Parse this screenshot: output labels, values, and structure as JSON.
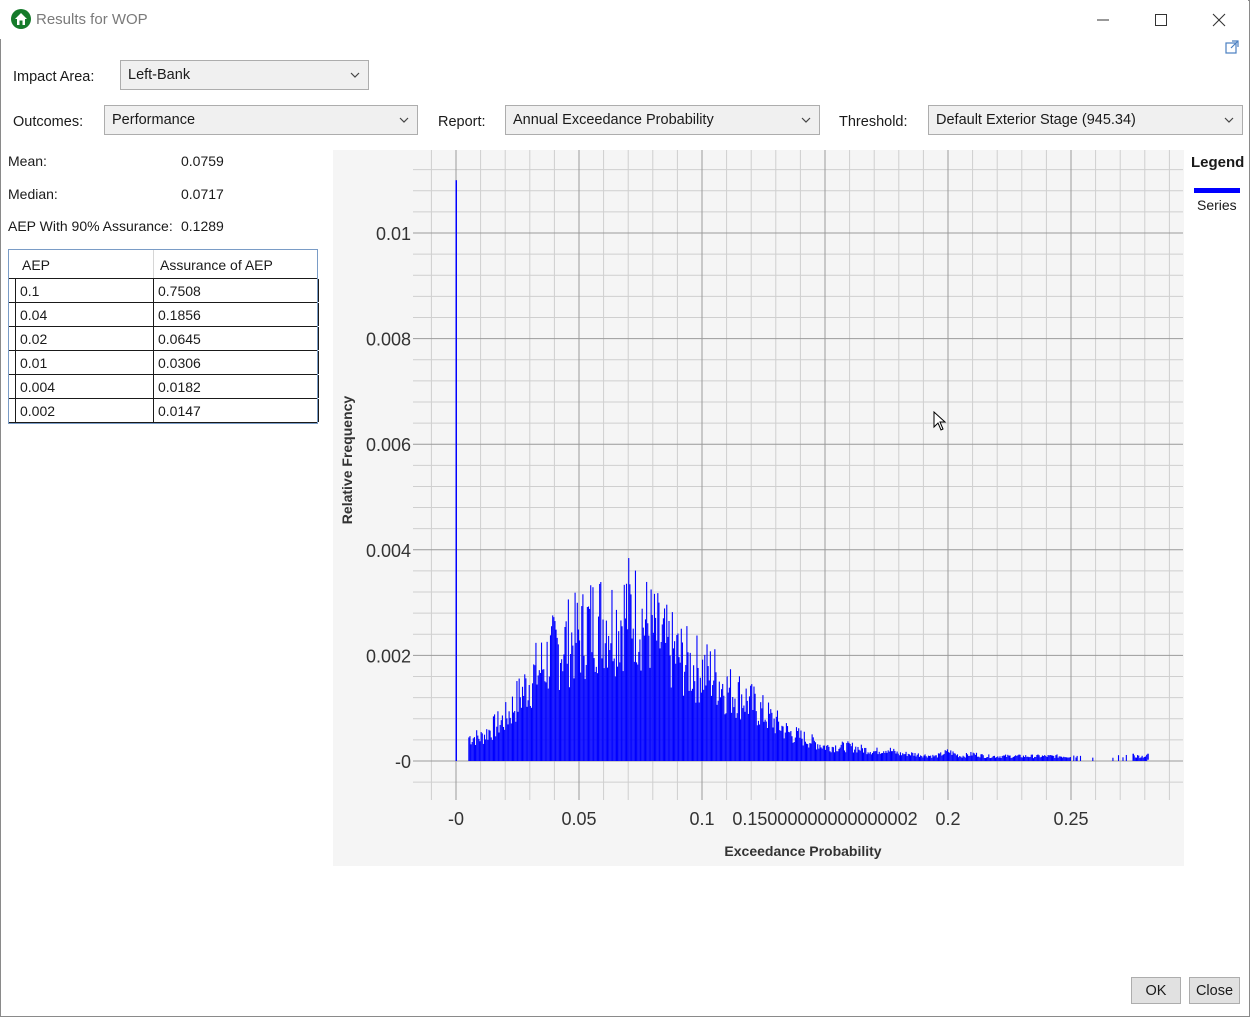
{
  "window": {
    "title": "Results for WOP",
    "controls": [
      "minimize-icon",
      "maximize-icon",
      "close-icon"
    ]
  },
  "filters": {
    "impact_area_label": "Impact Area:",
    "impact_area_value": "Left-Bank",
    "outcomes_label": "Outcomes:",
    "outcomes_value": "Performance",
    "report_label": "Report:",
    "report_value": "Annual Exceedance Probability",
    "threshold_label": "Threshold:",
    "threshold_value": "Default Exterior Stage (945.34)"
  },
  "stats": {
    "mean_label": "Mean:",
    "mean_value": "0.0759",
    "median_label": "Median:",
    "median_value": "0.0717",
    "aep90_label": "AEP With 90% Assurance:",
    "aep90_value": "0.1289"
  },
  "table": {
    "headers": [
      "AEP",
      "Assurance of AEP"
    ],
    "rows": [
      [
        "0.1",
        "0.7508"
      ],
      [
        "0.04",
        "0.1856"
      ],
      [
        "0.02",
        "0.0645"
      ],
      [
        "0.01",
        "0.0306"
      ],
      [
        "0.004",
        "0.0182"
      ],
      [
        "0.002",
        "0.0147"
      ]
    ]
  },
  "chart_data": {
    "type": "bar",
    "xlabel": "Exceedance Probability",
    "ylabel": "Relative Frequency",
    "xlim": [
      0,
      0.295
    ],
    "ylim": [
      -0.0002,
      0.011
    ],
    "x_ticks": [
      {
        "value": 0,
        "label": "-0"
      },
      {
        "value": 0.05,
        "label": "0.05"
      },
      {
        "value": 0.1,
        "label": "0.1"
      },
      {
        "value": 0.15,
        "label": "0.15000000000000002"
      },
      {
        "value": 0.2,
        "label": "0.2"
      },
      {
        "value": 0.25,
        "label": "0.25"
      }
    ],
    "y_ticks": [
      {
        "value": 0,
        "label": "-0"
      },
      {
        "value": 0.002,
        "label": "0.002"
      },
      {
        "value": 0.004,
        "label": "0.004"
      },
      {
        "value": 0.006,
        "label": "0.006"
      },
      {
        "value": 0.008,
        "label": "0.008"
      },
      {
        "value": 0.01,
        "label": "0.01"
      }
    ],
    "grid": true,
    "legend_position": "right",
    "color": "#0000ff",
    "series": [
      {
        "name": "Series",
        "points": [
          [
            0.0,
            0.011
          ],
          [
            0.005,
            0.0005
          ],
          [
            0.01,
            0.0005
          ],
          [
            0.015,
            0.0007
          ],
          [
            0.02,
            0.0009
          ],
          [
            0.025,
            0.0013
          ],
          [
            0.03,
            0.0017
          ],
          [
            0.035,
            0.002
          ],
          [
            0.04,
            0.0023
          ],
          [
            0.045,
            0.0025
          ],
          [
            0.05,
            0.0026
          ],
          [
            0.055,
            0.0029
          ],
          [
            0.06,
            0.003
          ],
          [
            0.065,
            0.0029
          ],
          [
            0.07,
            0.0032
          ],
          [
            0.075,
            0.003
          ],
          [
            0.08,
            0.0027
          ],
          [
            0.085,
            0.0024
          ],
          [
            0.09,
            0.0022
          ],
          [
            0.095,
            0.002
          ],
          [
            0.1,
            0.0019
          ],
          [
            0.105,
            0.0018
          ],
          [
            0.11,
            0.0015
          ],
          [
            0.115,
            0.0014
          ],
          [
            0.12,
            0.0012
          ],
          [
            0.125,
            0.001
          ],
          [
            0.13,
            0.0008
          ],
          [
            0.135,
            0.0006
          ],
          [
            0.14,
            0.0005
          ],
          [
            0.145,
            0.0004
          ],
          [
            0.15,
            0.0003
          ],
          [
            0.155,
            0.0003
          ],
          [
            0.16,
            0.0003
          ],
          [
            0.165,
            0.00025
          ],
          [
            0.17,
            0.0002
          ],
          [
            0.175,
            0.00025
          ],
          [
            0.18,
            0.00015
          ],
          [
            0.185,
            0.00015
          ],
          [
            0.19,
            0.00012
          ],
          [
            0.195,
            0.0001
          ],
          [
            0.2,
            0.0002
          ],
          [
            0.205,
            0.0001
          ],
          [
            0.21,
            0.00015
          ],
          [
            0.215,
            0.0001
          ],
          [
            0.22,
            0.0001
          ],
          [
            0.225,
            0.0001
          ],
          [
            0.23,
            0.0001
          ],
          [
            0.235,
            0.0001
          ],
          [
            0.24,
            0.0001
          ],
          [
            0.245,
            0.0001
          ],
          [
            0.25,
            0.0001
          ],
          [
            0.275,
            0.0001
          ],
          [
            0.281,
            0.0001
          ]
        ]
      }
    ]
  },
  "legend": {
    "title": "Legend",
    "series_label": "Series"
  },
  "buttons": {
    "ok": "OK",
    "close": "Close"
  }
}
